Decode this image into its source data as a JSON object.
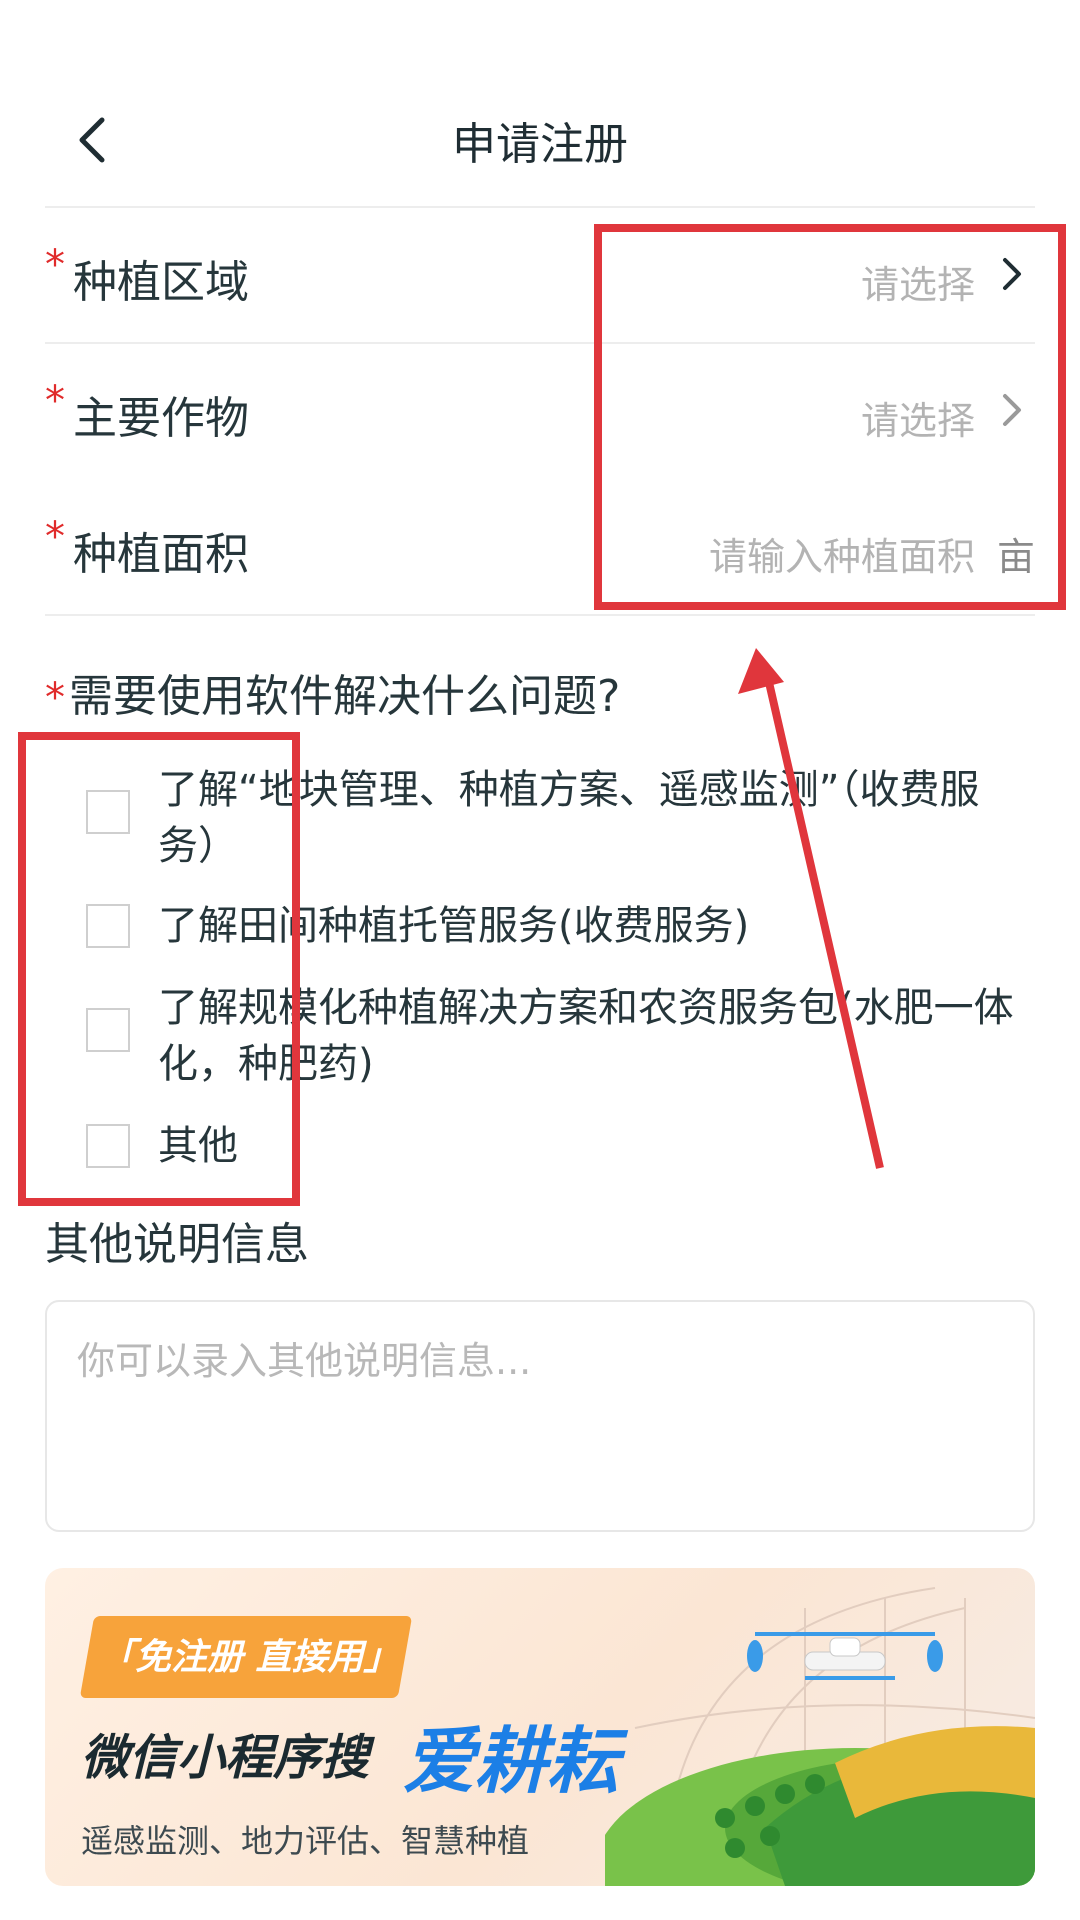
{
  "header": {
    "title": "申请注册",
    "back_icon": "chevron-left-icon"
  },
  "fields": [
    {
      "required_mark": "*",
      "label": "种植区域",
      "placeholder": "请选择",
      "icon": "chevron-right-icon",
      "icon_color": "#1f2d33"
    },
    {
      "required_mark": "*",
      "label": "主要作物",
      "placeholder": "请选择",
      "icon": "chevron-right-icon",
      "icon_color": "#9a9a9a"
    },
    {
      "required_mark": "*",
      "label": "种植面积",
      "placeholder": "请输入种植面积",
      "unit": "亩"
    }
  ],
  "question": {
    "required_mark": "*",
    "text": "需要使用软件解决什么问题?",
    "options": [
      {
        "label": "了解“地块管理、种植方案、遥感监测”（收费服务）",
        "checked": false
      },
      {
        "label": "了解田间种植托管服务(收费服务)",
        "checked": false
      },
      {
        "label": "了解规模化种植解决方案和农资服务包(水肥一体化，种肥药)",
        "checked": false
      },
      {
        "label": "其他",
        "checked": false
      }
    ]
  },
  "other_info": {
    "label": "其他说明信息",
    "placeholder": "你可以录入其他说明信息..."
  },
  "banner": {
    "tag": "「免注册 直接用」",
    "search_text": "微信小程序搜",
    "brand": "爱耕耘",
    "subtitle": "遥感监测、地力评估、智慧种植",
    "tag_color": "#f7a33b",
    "brand_color": "#1c7fe6"
  },
  "annotation": {
    "color": "#e0363c"
  }
}
